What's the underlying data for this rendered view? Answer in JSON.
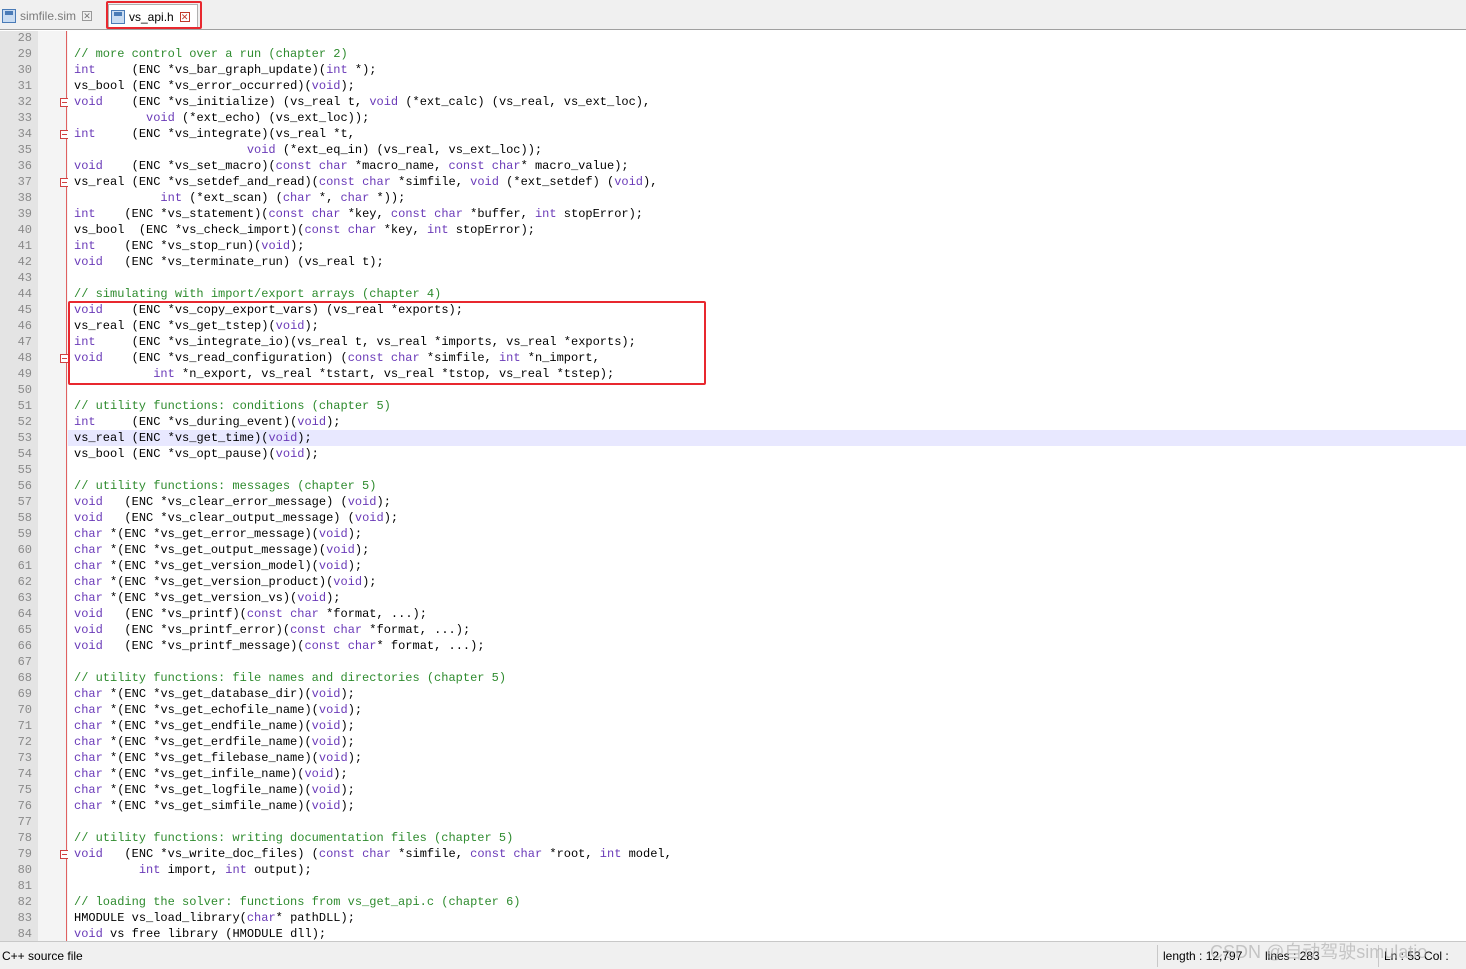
{
  "tabs": [
    {
      "label": "simfile.sim",
      "icon": "floppy-disk-icon",
      "active": false
    },
    {
      "label": "vs_api.h",
      "icon": "floppy-disk-icon",
      "active": true
    }
  ],
  "editor": {
    "lines": [
      {
        "n": "28",
        "t": ""
      },
      {
        "n": "29",
        "t": "// more control over a run (chapter 2)"
      },
      {
        "n": "30",
        "t": "int     (ENC *vs_bar_graph_update)(int *);"
      },
      {
        "n": "31",
        "t": "vs_bool (ENC *vs_error_occurred)(void);"
      },
      {
        "n": "32",
        "t": "void    (ENC *vs_initialize) (vs_real t, void (*ext_calc) (vs_real, vs_ext_loc),",
        "fold": true
      },
      {
        "n": "33",
        "t": "          void (*ext_echo) (vs_ext_loc));"
      },
      {
        "n": "34",
        "t": "int     (ENC *vs_integrate)(vs_real *t,",
        "fold": true
      },
      {
        "n": "35",
        "t": "                        void (*ext_eq_in) (vs_real, vs_ext_loc));"
      },
      {
        "n": "36",
        "t": "void    (ENC *vs_set_macro)(const char *macro_name, const char* macro_value);"
      },
      {
        "n": "37",
        "t": "vs_real (ENC *vs_setdef_and_read)(const char *simfile, void (*ext_setdef) (void),",
        "fold": true
      },
      {
        "n": "38",
        "t": "            int (*ext_scan) (char *, char *));"
      },
      {
        "n": "39",
        "t": "int    (ENC *vs_statement)(const char *key, const char *buffer, int stopError);"
      },
      {
        "n": "40",
        "t": "vs_bool  (ENC *vs_check_import)(const char *key, int stopError);"
      },
      {
        "n": "41",
        "t": "int    (ENC *vs_stop_run)(void);"
      },
      {
        "n": "42",
        "t": "void   (ENC *vs_terminate_run) (vs_real t);"
      },
      {
        "n": "43",
        "t": ""
      },
      {
        "n": "44",
        "t": "// simulating with import/export arrays (chapter 4)"
      },
      {
        "n": "45",
        "t": "void    (ENC *vs_copy_export_vars) (vs_real *exports);"
      },
      {
        "n": "46",
        "t": "vs_real (ENC *vs_get_tstep)(void);"
      },
      {
        "n": "47",
        "t": "int     (ENC *vs_integrate_io)(vs_real t, vs_real *imports, vs_real *exports);"
      },
      {
        "n": "48",
        "t": "void    (ENC *vs_read_configuration) (const char *simfile, int *n_import,",
        "fold": true
      },
      {
        "n": "49",
        "t": "           int *n_export, vs_real *tstart, vs_real *tstop, vs_real *tstep);"
      },
      {
        "n": "50",
        "t": ""
      },
      {
        "n": "51",
        "t": "// utility functions: conditions (chapter 5)"
      },
      {
        "n": "52",
        "t": "int     (ENC *vs_during_event)(void);"
      },
      {
        "n": "53",
        "t": "vs_real (ENC *vs_get_time)(void);",
        "current": true
      },
      {
        "n": "54",
        "t": "vs_bool (ENC *vs_opt_pause)(void);"
      },
      {
        "n": "55",
        "t": ""
      },
      {
        "n": "56",
        "t": "// utility functions: messages (chapter 5)"
      },
      {
        "n": "57",
        "t": "void   (ENC *vs_clear_error_message) (void);"
      },
      {
        "n": "58",
        "t": "void   (ENC *vs_clear_output_message) (void);"
      },
      {
        "n": "59",
        "t": "char *(ENC *vs_get_error_message)(void);"
      },
      {
        "n": "60",
        "t": "char *(ENC *vs_get_output_message)(void);"
      },
      {
        "n": "61",
        "t": "char *(ENC *vs_get_version_model)(void);"
      },
      {
        "n": "62",
        "t": "char *(ENC *vs_get_version_product)(void);"
      },
      {
        "n": "63",
        "t": "char *(ENC *vs_get_version_vs)(void);"
      },
      {
        "n": "64",
        "t": "void   (ENC *vs_printf)(const char *format, ...);"
      },
      {
        "n": "65",
        "t": "void   (ENC *vs_printf_error)(const char *format, ...);"
      },
      {
        "n": "66",
        "t": "void   (ENC *vs_printf_message)(const char* format, ...);"
      },
      {
        "n": "67",
        "t": ""
      },
      {
        "n": "68",
        "t": "// utility functions: file names and directories (chapter 5)"
      },
      {
        "n": "69",
        "t": "char *(ENC *vs_get_database_dir)(void);"
      },
      {
        "n": "70",
        "t": "char *(ENC *vs_get_echofile_name)(void);"
      },
      {
        "n": "71",
        "t": "char *(ENC *vs_get_endfile_name)(void);"
      },
      {
        "n": "72",
        "t": "char *(ENC *vs_get_erdfile_name)(void);"
      },
      {
        "n": "73",
        "t": "char *(ENC *vs_get_filebase_name)(void);"
      },
      {
        "n": "74",
        "t": "char *(ENC *vs_get_infile_name)(void);"
      },
      {
        "n": "75",
        "t": "char *(ENC *vs_get_logfile_name)(void);"
      },
      {
        "n": "76",
        "t": "char *(ENC *vs_get_simfile_name)(void);"
      },
      {
        "n": "77",
        "t": ""
      },
      {
        "n": "78",
        "t": "// utility functions: writing documentation files (chapter 5)"
      },
      {
        "n": "79",
        "t": "void   (ENC *vs_write_doc_files) (const char *simfile, const char *root, int model,",
        "fold": true
      },
      {
        "n": "80",
        "t": "         int import, int output);"
      },
      {
        "n": "81",
        "t": ""
      },
      {
        "n": "82",
        "t": "// loading the solver: functions from vs_get_api.c (chapter 6)"
      },
      {
        "n": "83",
        "t": "HMODULE vs_load_library(char* pathDLL);"
      },
      {
        "n": "84",
        "t": "void vs free library (HMODULE dll);"
      }
    ]
  },
  "status": {
    "file_type": "C++ source file",
    "length": "length : 12,797",
    "lines": "lines : 283",
    "position": "Ln : 53    Col :"
  },
  "watermark": "CSDN @自动驾驶simulatio",
  "colors": {
    "keyword": "#6a3ab8",
    "comment": "#2e8b2e",
    "annotation_box": "#e8282f",
    "current_line": "#e8e8ff"
  }
}
